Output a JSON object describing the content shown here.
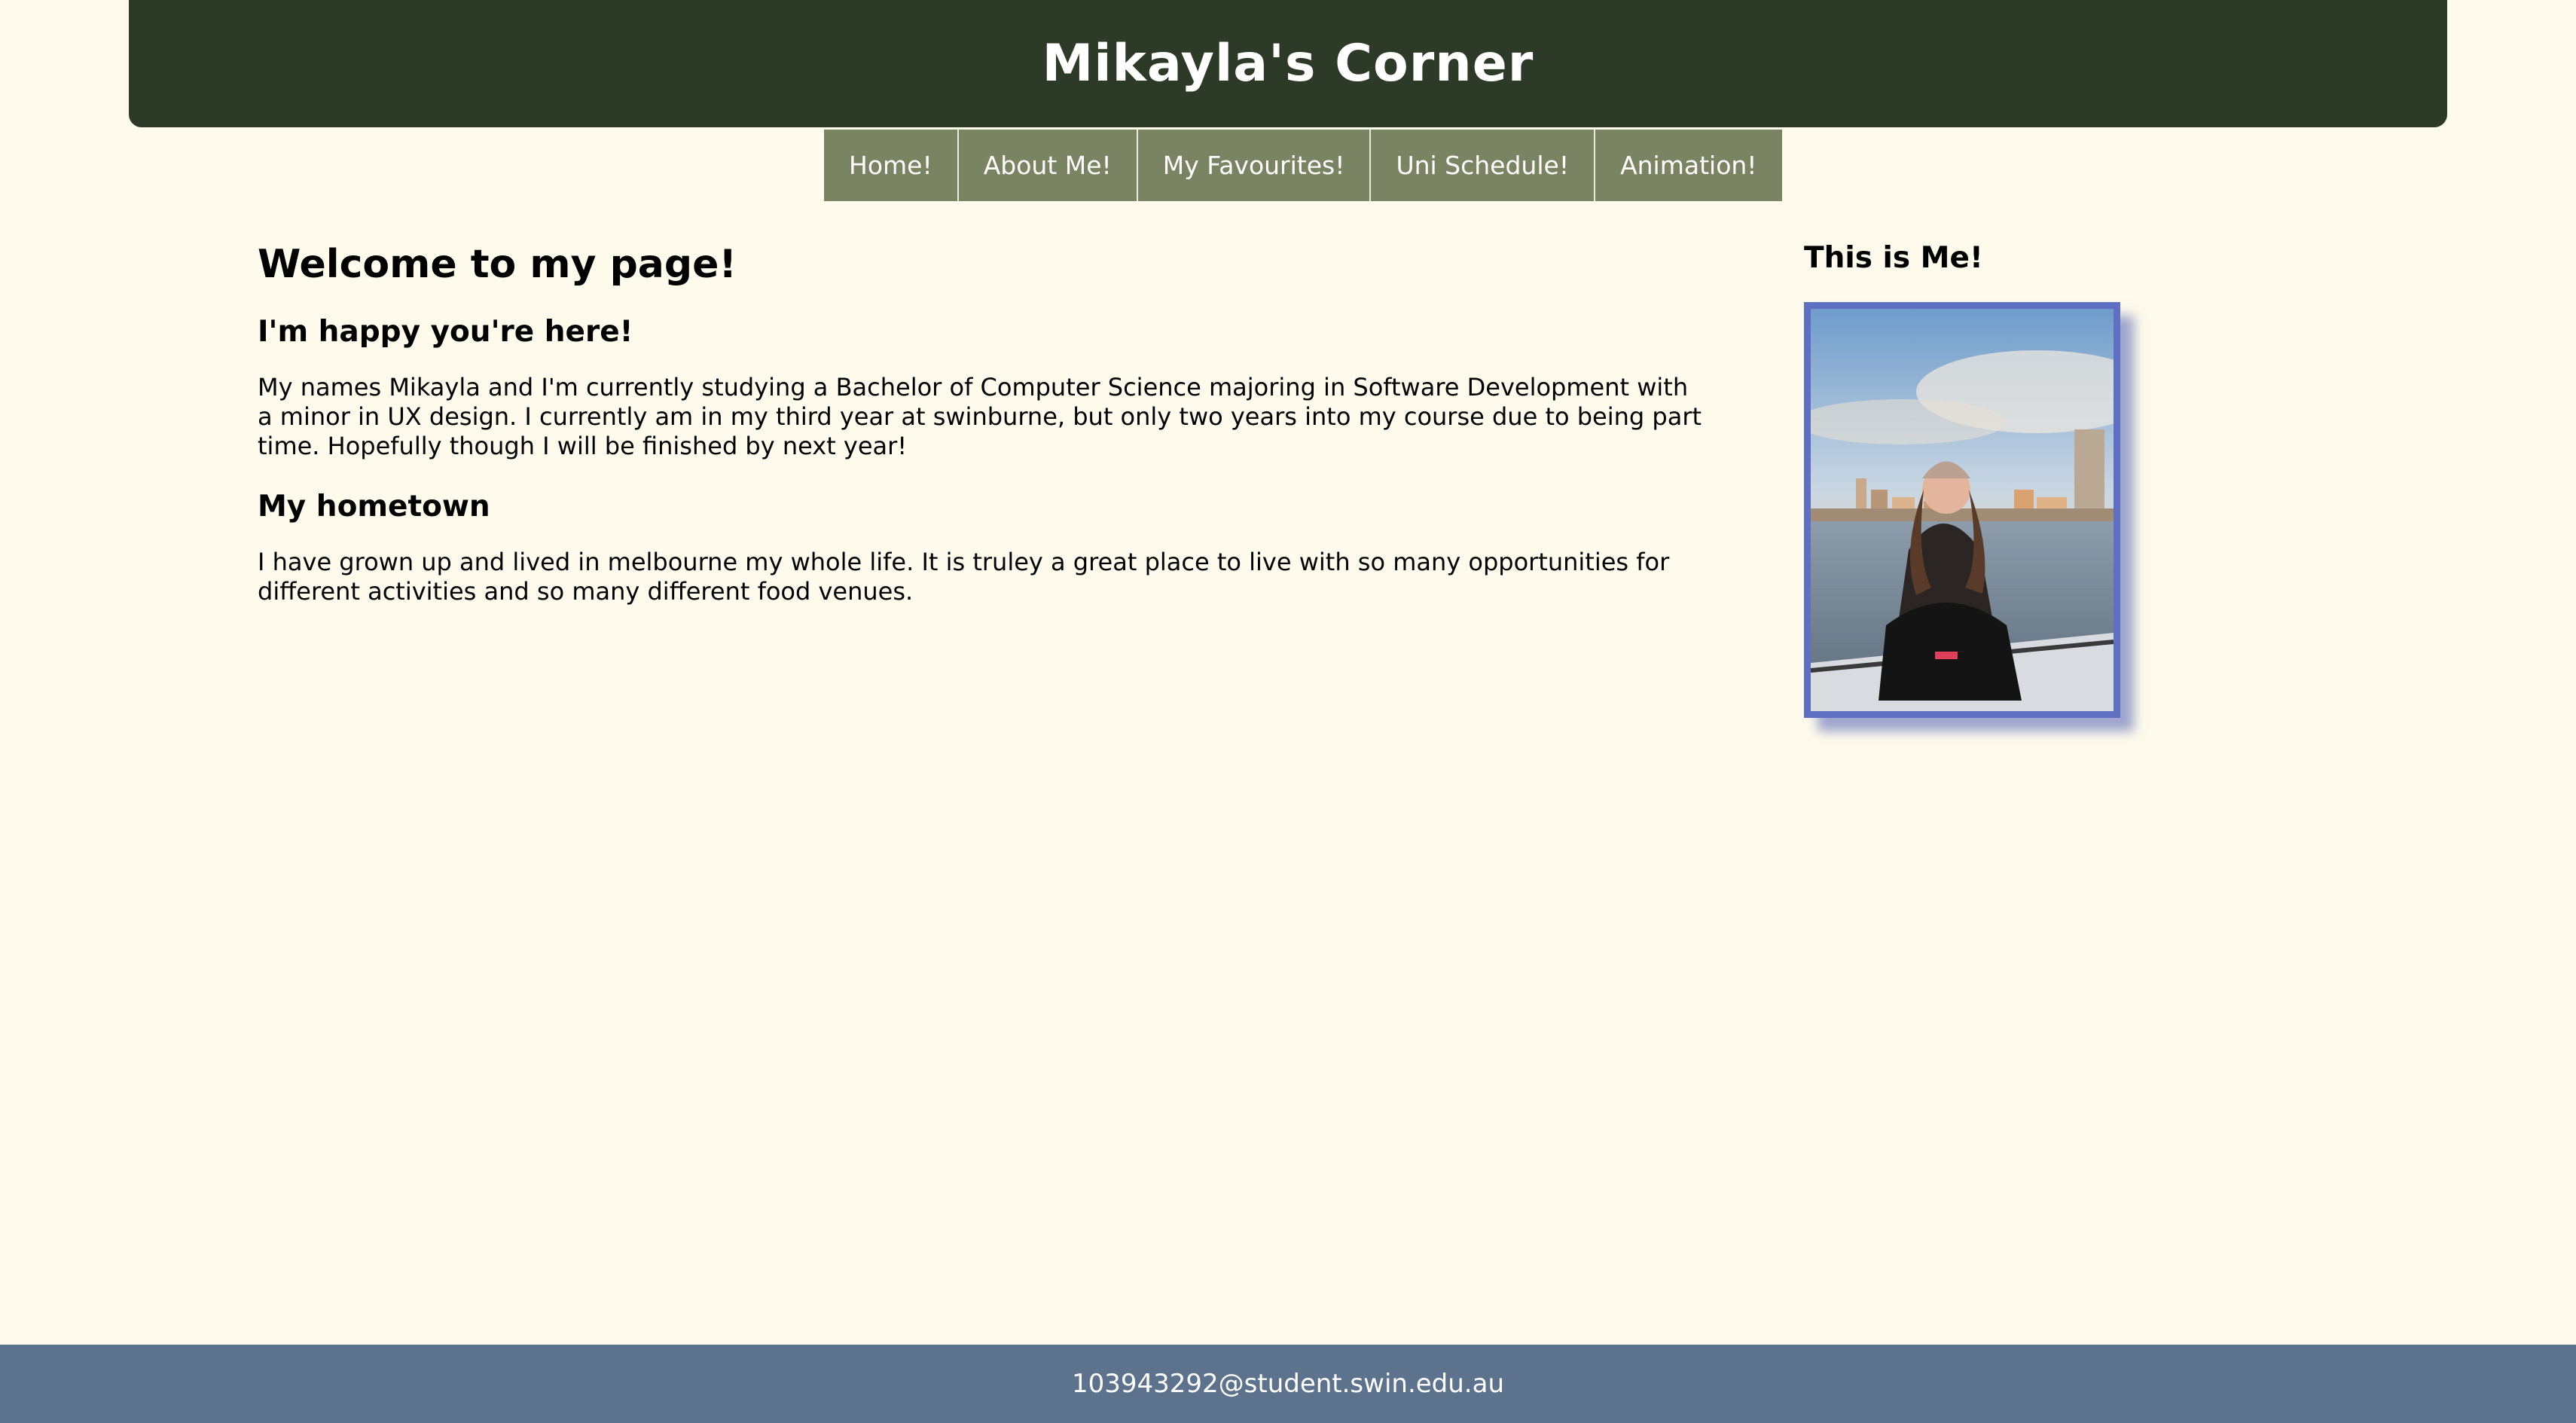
{
  "header": {
    "title": "Mikayla's Corner"
  },
  "nav": {
    "items": [
      {
        "label": "Home!"
      },
      {
        "label": "About Me!"
      },
      {
        "label": "My Favourites!"
      },
      {
        "label": "Uni Schedule!"
      },
      {
        "label": "Animation!"
      }
    ]
  },
  "main": {
    "heading": "Welcome to my page!",
    "subheading": "I'm happy you're here!",
    "intro": "My names Mikayla and I'm currently studying a Bachelor of Computer Science majoring in Software Development with a minor in UX design. I currently am in my third year at swinburne, but only two years into my course due to being part time. Hopefully though I will be finished by next year!",
    "hometown_heading": "My hometown",
    "hometown_text": "I have grown up and lived in melbourne my whole life. It is truley a great place to live with so many opportunities for different activities and so many different food venues."
  },
  "aside": {
    "heading": "This is Me!",
    "photo_frame_color": "#5f6fc2"
  },
  "footer": {
    "email": "103943292@student.swin.edu.au"
  },
  "colors": {
    "background": "#fefbec",
    "header": "#2d3a27",
    "nav": "#7b8462",
    "footer": "#5d728c"
  }
}
